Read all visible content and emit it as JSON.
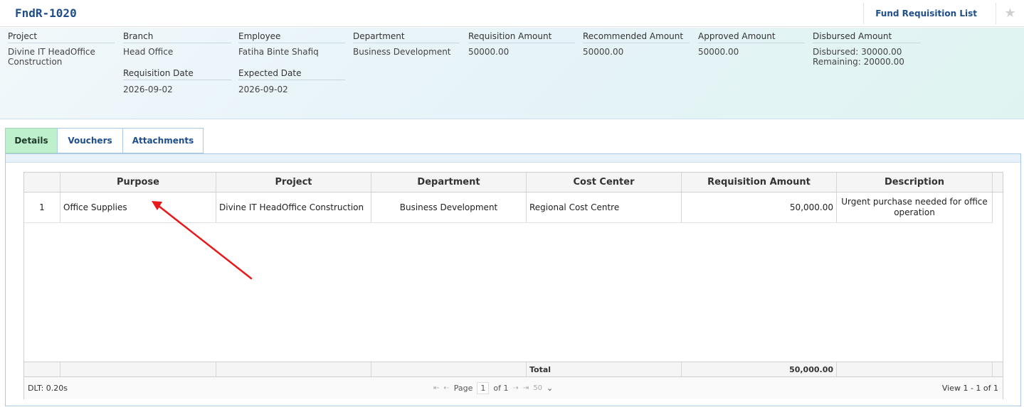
{
  "header": {
    "title": "FndR-1020",
    "list_link": "Fund Requisition List",
    "star_glyph": "★"
  },
  "info": {
    "project": {
      "label": "Project",
      "value": "Divine IT HeadOffice\nConstruction"
    },
    "branch": {
      "label": "Branch",
      "value": "Head Office"
    },
    "employee": {
      "label": "Employee",
      "value": "Fatiha Binte Shafiq"
    },
    "department": {
      "label": "Department",
      "value": "Business Development"
    },
    "requisition_amount": {
      "label": "Requisition Amount",
      "value": "50000.00"
    },
    "recommended_amount": {
      "label": "Recommended Amount",
      "value": "50000.00"
    },
    "approved_amount": {
      "label": "Approved Amount",
      "value": "50000.00"
    },
    "disbursed_amount": {
      "label": "Disbursed Amount",
      "value": "Disbursed: 30000.00\nRemaining: 20000.00"
    },
    "requisition_date": {
      "label": "Requisition Date",
      "value": "2026-09-02"
    },
    "expected_date": {
      "label": "Expected Date",
      "value": "2026-09-02"
    }
  },
  "tabs": [
    {
      "label": "Details",
      "active": true
    },
    {
      "label": "Vouchers",
      "active": false
    },
    {
      "label": "Attachments",
      "active": false
    }
  ],
  "grid": {
    "columns": [
      "",
      "Purpose",
      "Project",
      "Department",
      "Cost Center",
      "Requisition Amount",
      "Description"
    ],
    "rows": [
      {
        "sl": "1",
        "purpose": "Office Supplies",
        "project": "Divine IT HeadOffice Construction",
        "department": "Business Development",
        "cost_center": "Regional Cost Centre",
        "amount": "50,000.00",
        "description": "Urgent purchase needed for office operation"
      }
    ],
    "footer": {
      "total_label": "Total",
      "total_value": "50,000.00"
    },
    "pager": {
      "dlt": "DLT: 0.20s",
      "page_label": "Page",
      "page_value": "1",
      "of_label": "of 1",
      "page_size": "50",
      "view": "View 1 - 1 of 1",
      "first_icon": "⇤",
      "prev_icon": "⇠",
      "next_icon": "⇢",
      "last_icon": "⇥",
      "dropdown_icon": "⌄"
    }
  },
  "colors": {
    "accent": "#1f4e8c",
    "active_tab": "#bff0cd",
    "annotation_arrow": "#e8191a"
  }
}
